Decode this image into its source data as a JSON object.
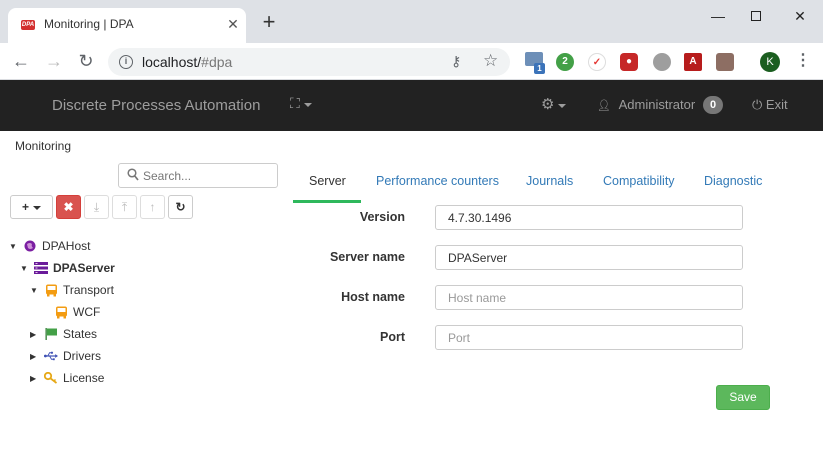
{
  "browser": {
    "tab_title": "Monitoring | DPA",
    "favicon_text": "DPA",
    "url_host": "localhost/",
    "url_path": "#dpa",
    "profile_initial": "K",
    "extensions": [
      {
        "name": "mail-extension-icon",
        "badge": "1"
      },
      {
        "name": "green-counter-extension-icon",
        "text": "2"
      },
      {
        "name": "pocket-extension-icon"
      },
      {
        "name": "ublock-extension-icon"
      },
      {
        "name": "grey-circle-extension-icon"
      },
      {
        "name": "pdf-extension-icon"
      },
      {
        "name": "stamp-extension-icon"
      }
    ]
  },
  "navbar": {
    "brand": "Discrete Processes Automation",
    "user": "Administrator",
    "badge_count": "0",
    "exit_label": "Exit"
  },
  "breadcrumb": "Monitoring",
  "sidebar": {
    "search_placeholder": "Search...",
    "tree": [
      {
        "label": "DPAHost",
        "icon": "globe-icon",
        "level": 0,
        "expanded": true
      },
      {
        "label": "DPAServer",
        "icon": "server-icon",
        "level": 1,
        "expanded": true,
        "bold": true
      },
      {
        "label": "Transport",
        "icon": "bus-icon",
        "level": 2,
        "expanded": true
      },
      {
        "label": "WCF",
        "icon": "bus-icon",
        "level": 3
      },
      {
        "label": "States",
        "icon": "flag-icon",
        "level": 2,
        "expanded": false
      },
      {
        "label": "Drivers",
        "icon": "usb-icon",
        "level": 2,
        "expanded": false
      },
      {
        "label": "License",
        "icon": "key-icon",
        "level": 2,
        "expanded": false
      }
    ]
  },
  "tabs": [
    {
      "label": "Server",
      "active": true
    },
    {
      "label": "Performance counters"
    },
    {
      "label": "Journals"
    },
    {
      "label": "Compatibility"
    },
    {
      "label": "Diagnostic"
    }
  ],
  "form": {
    "version_label": "Version",
    "version_value": "4.7.30.1496",
    "server_name_label": "Server name",
    "server_name_value": "DPAServer",
    "host_name_label": "Host name",
    "host_name_placeholder": "Host name",
    "port_label": "Port",
    "port_placeholder": "Port",
    "save_label": "Save"
  },
  "colors": {
    "navbar_bg": "#222222",
    "tab_active_underline": "#2eb85c",
    "save_button": "#5cb85c",
    "delete_button": "#d9534f",
    "link": "#337ab7"
  }
}
